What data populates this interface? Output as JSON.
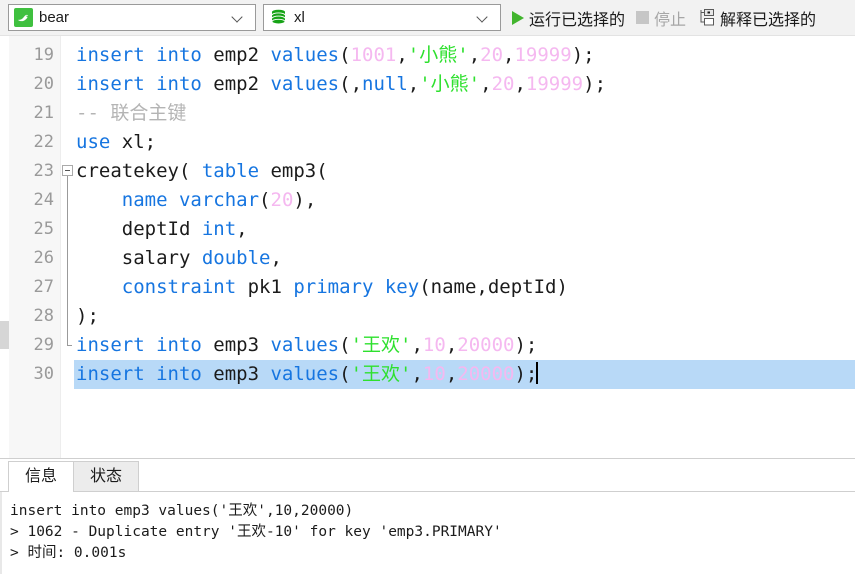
{
  "toolbar": {
    "connection": {
      "icon": "mysql-dolphin-icon",
      "value": "bear",
      "caret": "chevron-down-icon"
    },
    "database": {
      "icon": "database-cylinder-icon",
      "value": "xl",
      "caret": "chevron-down-icon"
    },
    "run_selected": {
      "label": "运行已选择的",
      "icon": "play-icon"
    },
    "stop": {
      "label": "停止",
      "icon": "stop-square-icon",
      "disabled": true
    },
    "explain_selected": {
      "label": "解释已选择的",
      "icon": "explain-tree-icon"
    }
  },
  "editor": {
    "first_line_number": 19,
    "lines": [
      {
        "num": "19",
        "fold": "none",
        "selected": false,
        "tokens": [
          {
            "t": "insert into",
            "c": "kw"
          },
          {
            "t": " emp2 ",
            "c": "pln"
          },
          {
            "t": "values",
            "c": "kw"
          },
          {
            "t": "(",
            "c": "pln"
          },
          {
            "t": "1001",
            "c": "num"
          },
          {
            "t": ",",
            "c": "pln"
          },
          {
            "t": "'小熊'",
            "c": "str"
          },
          {
            "t": ",",
            "c": "pln"
          },
          {
            "t": "20",
            "c": "num"
          },
          {
            "t": ",",
            "c": "pln"
          },
          {
            "t": "19999",
            "c": "num"
          },
          {
            "t": ");",
            "c": "pln"
          }
        ]
      },
      {
        "num": "20",
        "fold": "none",
        "selected": false,
        "tokens": [
          {
            "t": "insert into",
            "c": "kw"
          },
          {
            "t": " emp2 ",
            "c": "pln"
          },
          {
            "t": "values",
            "c": "kw"
          },
          {
            "t": "(,",
            "c": "pln"
          },
          {
            "t": "null",
            "c": "kw"
          },
          {
            "t": ",",
            "c": "pln"
          },
          {
            "t": "'小熊'",
            "c": "str"
          },
          {
            "t": ",",
            "c": "pln"
          },
          {
            "t": "20",
            "c": "num"
          },
          {
            "t": ",",
            "c": "pln"
          },
          {
            "t": "19999",
            "c": "num"
          },
          {
            "t": ");",
            "c": "pln"
          }
        ]
      },
      {
        "num": "21",
        "fold": "none",
        "selected": false,
        "tokens": [
          {
            "t": "-- 联合主键",
            "c": "cmt"
          }
        ]
      },
      {
        "num": "22",
        "fold": "none",
        "selected": false,
        "tokens": [
          {
            "t": "use",
            "c": "kw"
          },
          {
            "t": " xl;",
            "c": "pln"
          }
        ]
      },
      {
        "num": "23",
        "fold": "start",
        "selected": false,
        "tokens": [
          {
            "t": "createkey( ",
            "c": "pln"
          },
          {
            "t": "table",
            "c": "kw"
          },
          {
            "t": " emp3(",
            "c": "pln"
          }
        ]
      },
      {
        "num": "24",
        "fold": "mid",
        "selected": false,
        "tokens": [
          {
            "t": "    ",
            "c": "pln"
          },
          {
            "t": "name varchar",
            "c": "kw"
          },
          {
            "t": "(",
            "c": "pln"
          },
          {
            "t": "20",
            "c": "num"
          },
          {
            "t": "),",
            "c": "pln"
          }
        ]
      },
      {
        "num": "25",
        "fold": "mid",
        "selected": false,
        "tokens": [
          {
            "t": "    deptId ",
            "c": "pln"
          },
          {
            "t": "int",
            "c": "kw"
          },
          {
            "t": ",",
            "c": "pln"
          }
        ]
      },
      {
        "num": "26",
        "fold": "mid",
        "selected": false,
        "tokens": [
          {
            "t": "    salary ",
            "c": "pln"
          },
          {
            "t": "double",
            "c": "kw"
          },
          {
            "t": ",",
            "c": "pln"
          }
        ]
      },
      {
        "num": "27",
        "fold": "mid",
        "selected": false,
        "tokens": [
          {
            "t": "    ",
            "c": "pln"
          },
          {
            "t": "constraint",
            "c": "kw"
          },
          {
            "t": " pk1 ",
            "c": "pln"
          },
          {
            "t": "primary key",
            "c": "kw"
          },
          {
            "t": "(name,deptId)",
            "c": "pln"
          }
        ]
      },
      {
        "num": "28",
        "fold": "mid",
        "selected": false,
        "tokens": [
          {
            "t": ");",
            "c": "pln"
          }
        ]
      },
      {
        "num": "29",
        "fold": "end",
        "selected": false,
        "tokens": [
          {
            "t": "insert into",
            "c": "kw"
          },
          {
            "t": " emp3 ",
            "c": "pln"
          },
          {
            "t": "values",
            "c": "kw"
          },
          {
            "t": "(",
            "c": "pln"
          },
          {
            "t": "'王欢'",
            "c": "str"
          },
          {
            "t": ",",
            "c": "pln"
          },
          {
            "t": "10",
            "c": "num"
          },
          {
            "t": ",",
            "c": "pln"
          },
          {
            "t": "20000",
            "c": "num"
          },
          {
            "t": ");",
            "c": "pln"
          }
        ]
      },
      {
        "num": "30",
        "fold": "none",
        "selected": true,
        "cursor": true,
        "tokens": [
          {
            "t": "insert into",
            "c": "kw"
          },
          {
            "t": " emp3 ",
            "c": "pln"
          },
          {
            "t": "values",
            "c": "kw"
          },
          {
            "t": "(",
            "c": "pln"
          },
          {
            "t": "'王欢'",
            "c": "str"
          },
          {
            "t": ",",
            "c": "pln"
          },
          {
            "t": "10",
            "c": "num"
          },
          {
            "t": ",",
            "c": "pln"
          },
          {
            "t": "20000",
            "c": "num"
          },
          {
            "t": ");",
            "c": "pln"
          }
        ]
      }
    ]
  },
  "bottom": {
    "tabs": [
      {
        "label": "信息",
        "active": true
      },
      {
        "label": "状态",
        "active": false
      }
    ],
    "messages": [
      "insert into emp3 values('王欢',10,20000)",
      "> 1062 - Duplicate entry '王欢-10' for key 'emp3.PRIMARY'",
      "> 时间: 0.001s"
    ]
  },
  "colors": {
    "keyword": "#1675e0",
    "number": "#f5b8f0",
    "string": "#2ee02e",
    "comment": "#b4b4b4",
    "selection": "#b8d9f7",
    "accent_green": "#42b52e"
  }
}
